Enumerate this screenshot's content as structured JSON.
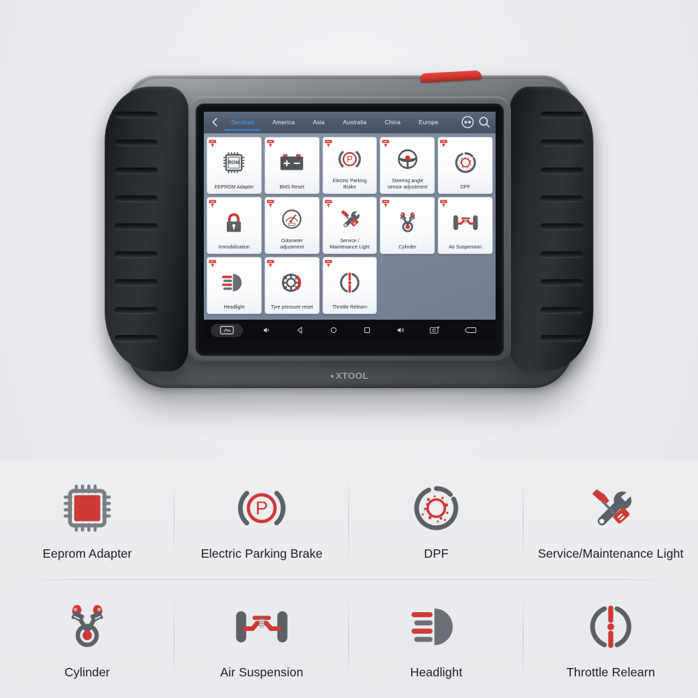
{
  "device": {
    "brand": "XTOOL",
    "brand_dot": "•",
    "accent_red": "#cc3228",
    "shell_color": "#5e6266",
    "grip_color": "#23262a"
  },
  "screen": {
    "topbar": {
      "back_icon": "chevron-left-icon",
      "tabs": [
        {
          "label": "Services",
          "active": true
        },
        {
          "label": "America",
          "active": false
        },
        {
          "label": "Asia",
          "active": false
        },
        {
          "label": "Australia",
          "active": false
        },
        {
          "label": "China",
          "active": false
        },
        {
          "label": "Europe",
          "active": false
        }
      ],
      "active_tab_color": "#4aa8f5",
      "actions": [
        {
          "name": "transfer-swap-icon",
          "label": "Swap"
        },
        {
          "name": "search-icon",
          "label": "Search"
        }
      ]
    },
    "grid": {
      "badge": "PDF",
      "tiles": [
        {
          "label": "EEPROM Adapter",
          "icon": "chip-icon"
        },
        {
          "label": "BMS Reset",
          "icon": "battery-icon"
        },
        {
          "label": "Electric Parking\nBrake",
          "icon": "parking-brake-icon"
        },
        {
          "label": "Steering angle\nsensor adjustment",
          "icon": "steering-wheel-icon"
        },
        {
          "label": "DPF",
          "icon": "dpf-filter-icon"
        },
        {
          "label": "Immobilization",
          "icon": "lock-icon"
        },
        {
          "label": "Odometer\nadjustment",
          "icon": "odometer-icon"
        },
        {
          "label": "Service /\nMaintenance Light",
          "icon": "wrench-screwdriver-icon"
        },
        {
          "label": "Cylinder",
          "icon": "cylinder-icon"
        },
        {
          "label": "Air Suspension",
          "icon": "air-suspension-icon"
        },
        {
          "label": "Headlight",
          "icon": "headlight-icon"
        },
        {
          "label": "Tyre pressure reset",
          "icon": "tyre-icon"
        },
        {
          "label": "Throttle Relearn",
          "icon": "throttle-icon"
        }
      ]
    },
    "navbar": {
      "buttons": [
        {
          "name": "screenshot-pill-icon",
          "label": "Screenshot"
        },
        {
          "name": "volume-down-icon",
          "label": "Volume down"
        },
        {
          "name": "back-icon",
          "label": "Back"
        },
        {
          "name": "home-icon",
          "label": "Home"
        },
        {
          "name": "recents-icon",
          "label": "Recent apps"
        },
        {
          "name": "volume-up-icon",
          "label": "Volume up"
        },
        {
          "name": "camera-icon",
          "label": "Camera"
        },
        {
          "name": "battery-icon",
          "label": "Battery"
        }
      ]
    }
  },
  "features": [
    {
      "label": "Eeprom Adapter",
      "icon": "chip-icon"
    },
    {
      "label": "Electric Parking Brake",
      "icon": "parking-brake-icon"
    },
    {
      "label": "DPF",
      "icon": "dpf-filter-icon"
    },
    {
      "label": "Service/Maintenance Light",
      "icon": "wrench-screwdriver-icon"
    },
    {
      "label": "Cylinder",
      "icon": "cylinder-icon"
    },
    {
      "label": "Air Suspension",
      "icon": "air-suspension-icon"
    },
    {
      "label": "Headlight",
      "icon": "headlight-icon"
    },
    {
      "label": "Throttle Relearn",
      "icon": "throttle-icon"
    }
  ]
}
